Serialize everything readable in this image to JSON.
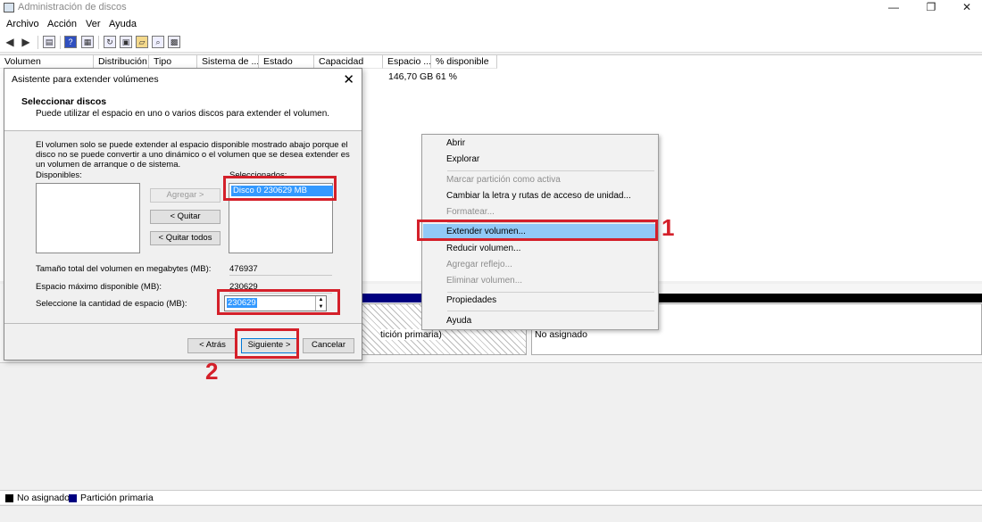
{
  "window": {
    "title": "Administración de discos",
    "controls": {
      "minimize": "—",
      "restore": "❐",
      "close": "✕"
    }
  },
  "menu": [
    "Archivo",
    "Acción",
    "Ver",
    "Ayuda"
  ],
  "volume_list": {
    "columns": [
      "Volumen",
      "Distribución",
      "Tipo",
      "Sistema de ...",
      "Estado",
      "Capacidad",
      "Espacio ...",
      "% disponible"
    ],
    "row": {
      "espacio": "146,70 GB",
      "porcentaje": "61 %"
    }
  },
  "graph": {
    "partition_text": "tición primaria)",
    "unallocated_text": "No asignado"
  },
  "legend": [
    {
      "label": "No asignado",
      "color": "#000000"
    },
    {
      "label": "Partición primaria",
      "color": "#000080"
    }
  ],
  "dialog": {
    "title": "Asistente para extender volúmenes",
    "heading": "Seleccionar discos",
    "subheading": "Puede utilizar el espacio en uno o varios discos para extender el volumen.",
    "description": "El volumen solo se puede extender al espacio disponible mostrado abajo porque el disco no se puede convertir a uno dinámico o el volumen que se desea extender es un volumen de arranque o de sistema.",
    "available_label": "Disponibles:",
    "selected_label": "Seleccionados:",
    "selected_item": "Disco 0     230629 MB",
    "buttons": {
      "add": "Agregar >",
      "remove": "< Quitar",
      "remove_all": "< Quitar todos",
      "back": "< Atrás",
      "next": "Siguiente >",
      "cancel": "Cancelar"
    },
    "total_size_label": "Tamaño total del volumen en megabytes (MB):",
    "total_size_value": "476937",
    "max_space_label": "Espacio máximo disponible (MB):",
    "max_space_value": "230629",
    "select_amount_label": "Seleccione la cantidad de espacio (MB):",
    "select_amount_value": "230629"
  },
  "context_menu": {
    "items": [
      {
        "label": "Abrir",
        "enabled": true
      },
      {
        "label": "Explorar",
        "enabled": true
      },
      {
        "label": "Marcar partición como activa",
        "enabled": false
      },
      {
        "label": "Cambiar la letra y rutas de acceso de unidad...",
        "enabled": true
      },
      {
        "label": "Formatear...",
        "enabled": false
      },
      {
        "label": "Extender volumen...",
        "enabled": true,
        "highlighted": true
      },
      {
        "label": "Reducir volumen...",
        "enabled": true
      },
      {
        "label": "Agregar reflejo...",
        "enabled": false
      },
      {
        "label": "Eliminar volumen...",
        "enabled": false
      },
      {
        "label": "Propiedades",
        "enabled": true
      },
      {
        "label": "Ayuda",
        "enabled": true
      }
    ]
  },
  "annotations": {
    "step1": "1",
    "step2": "2",
    "color": "#d4202a"
  }
}
